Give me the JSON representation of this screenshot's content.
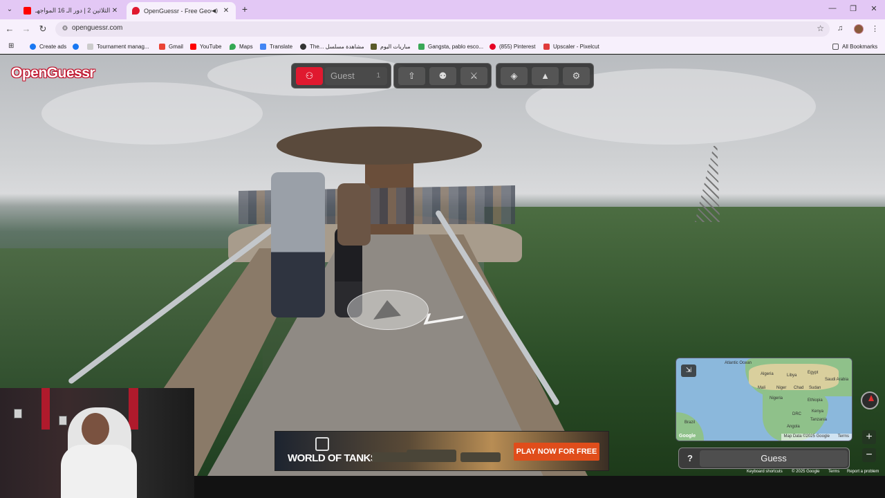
{
  "browser": {
    "tabs": [
      {
        "title": "تحدي الثلاثين 2 | دور الـ 16 المواجهـ",
        "active": false,
        "favicon": "youtube-icon"
      },
      {
        "title": "OpenGuessr - Free GeoGue",
        "active": true,
        "favicon": "openguessr-pin-icon"
      }
    ],
    "url": "openguessr.com",
    "bookmarks": [
      {
        "label": "Create ads",
        "icon": "facebook-icon",
        "color": "#1877f2"
      },
      {
        "label": "",
        "icon": "facebook-icon",
        "color": "#1877f2"
      },
      {
        "label": "Tournament manag...",
        "icon": "tournament-icon",
        "color": "#ddd"
      },
      {
        "label": "Gmail",
        "icon": "gmail-icon",
        "color": "#ea4335"
      },
      {
        "label": "YouTube",
        "icon": "youtube-icon",
        "color": "#ff0000"
      },
      {
        "label": "Maps",
        "icon": "maps-pin-icon",
        "color": "#34a853"
      },
      {
        "label": "Translate",
        "icon": "translate-icon",
        "color": "#4285f4"
      },
      {
        "label": "The... مشاهدة مسلسل",
        "icon": "globe-icon",
        "color": "#333"
      },
      {
        "label": "مباريات اليوم",
        "icon": "soccer-icon",
        "color": "#5a5a2a"
      },
      {
        "label": "Gangsta, pablo esco...",
        "icon": "bookmark-icon",
        "color": "#3aa857"
      },
      {
        "label": "(855) Pinterest",
        "icon": "pinterest-icon",
        "color": "#e60023"
      },
      {
        "label": "Upscaler - Pixelcut",
        "icon": "pixelcut-icon",
        "color": "#e03b3b"
      }
    ],
    "all_bookmarks": "All Bookmarks"
  },
  "game": {
    "logo": "OpenGuessr",
    "player_name": "Guest",
    "player_count": "1",
    "guess_label": "Guess",
    "help_label": "?",
    "map_labels": [
      "Atlantic Ocean",
      "Algeria",
      "Libya",
      "Egypt",
      "Saudi Arabia",
      "Mali",
      "Niger",
      "Chad",
      "Sudan",
      "Nigeria",
      "Ethiopia",
      "DRC",
      "Kenya",
      "Tanzania",
      "Angola",
      "Brazil"
    ],
    "map_attribution": "Map Data ©2025 Google",
    "map_terms": "Terms",
    "google": "Google"
  },
  "streetview_footer": {
    "shortcuts": "Keyboard shortcuts",
    "copyright": "© 2025 Google",
    "terms": "Terms",
    "report": "Report a problem"
  },
  "ad": {
    "brand": "WORLD OF TANKS",
    "cta": "PLAY NOW FOR FREE"
  },
  "colors": {
    "accent_red": "#e0192f",
    "tab_bar": "#e3c8f5",
    "ad_cta": "#e04d1b"
  }
}
